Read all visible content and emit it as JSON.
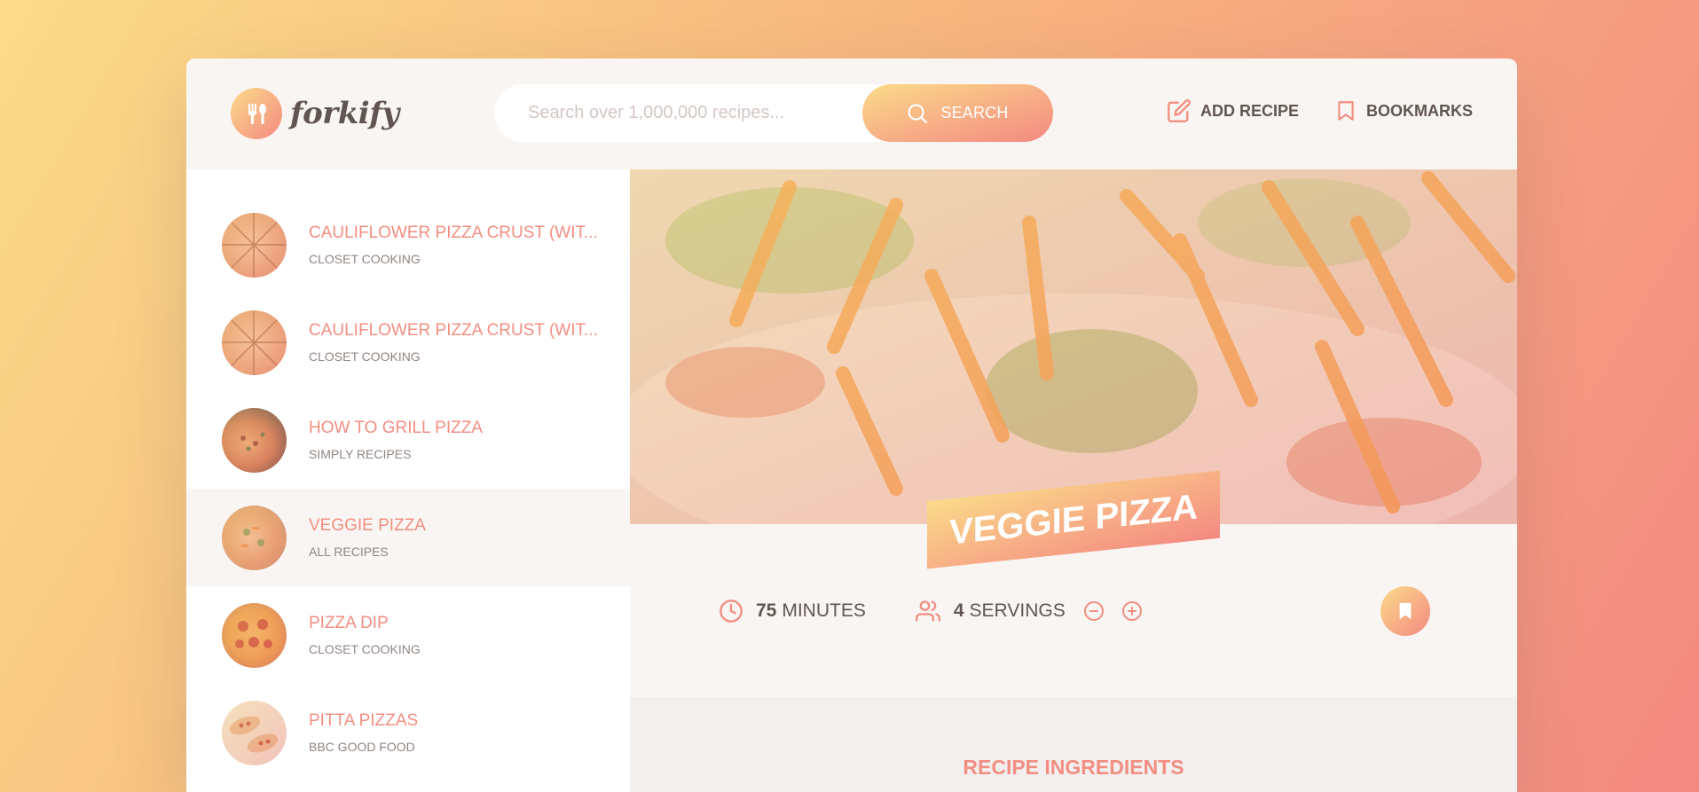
{
  "header": {
    "logo_text": "forkify",
    "search": {
      "placeholder": "Search over 1,000,000 recipes...",
      "value": "",
      "button_label": "SEARCH"
    },
    "nav": {
      "add_recipe_label": "ADD RECIPE",
      "bookmarks_label": "BOOKMARKS"
    }
  },
  "results": [
    {
      "title": "CAULIFLOWER PIZZA CRUST (WIT...",
      "publisher": "CLOSET COOKING",
      "image_icon": "pizza-slices-thumbnail"
    },
    {
      "title": "CAULIFLOWER PIZZA CRUST (WIT...",
      "publisher": "CLOSET COOKING",
      "image_icon": "pizza-slices-thumbnail"
    },
    {
      "title": "HOW TO GRILL PIZZA",
      "publisher": "SIMPLY RECIPES",
      "image_icon": "grilled-pizza-thumbnail"
    },
    {
      "title": "VEGGIE PIZZA",
      "publisher": "ALL RECIPES",
      "image_icon": "veggie-pizza-thumbnail"
    },
    {
      "title": "PIZZA DIP",
      "publisher": "CLOSET COOKING",
      "image_icon": "pepperoni-pizza-thumbnail"
    },
    {
      "title": "PITTA PIZZAS",
      "publisher": "BBC GOOD FOOD",
      "image_icon": "pitta-pizza-thumbnail"
    }
  ],
  "recipe": {
    "title": "VEGGIE PIZZA",
    "cooking_time": "75",
    "cooking_time_unit": "MINUTES",
    "servings": "4",
    "servings_unit": "SERVINGS",
    "ingredients_heading": "RECIPE INGREDIENTS"
  },
  "colors": {
    "accent": "#f38e82",
    "gradient_start": "#fbdb89",
    "gradient_end": "#f48982",
    "text": "#615551",
    "background": "#f9f5f3"
  }
}
